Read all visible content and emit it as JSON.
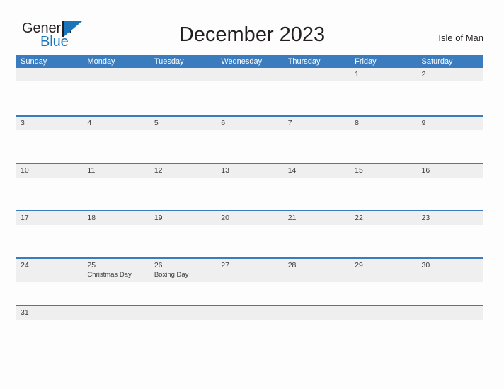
{
  "logo": {
    "word_general": "General",
    "word_blue": "Blue"
  },
  "header": {
    "title": "December 2023",
    "location": "Isle of Man"
  },
  "colors": {
    "header_blue": "#3a7cbd",
    "day_strip_gray": "#efefef",
    "logo_blue": "#1b75bb",
    "text_dark": "#231f20",
    "page_background": "#fdfdfd"
  },
  "calendar": {
    "weekdays": [
      "Sunday",
      "Monday",
      "Tuesday",
      "Wednesday",
      "Thursday",
      "Friday",
      "Saturday"
    ],
    "weeks": [
      {
        "tall": false,
        "days": [
          {
            "num": "",
            "event": ""
          },
          {
            "num": "",
            "event": ""
          },
          {
            "num": "",
            "event": ""
          },
          {
            "num": "",
            "event": ""
          },
          {
            "num": "",
            "event": ""
          },
          {
            "num": "1",
            "event": ""
          },
          {
            "num": "2",
            "event": ""
          }
        ]
      },
      {
        "tall": false,
        "days": [
          {
            "num": "3",
            "event": ""
          },
          {
            "num": "4",
            "event": ""
          },
          {
            "num": "5",
            "event": ""
          },
          {
            "num": "6",
            "event": ""
          },
          {
            "num": "7",
            "event": ""
          },
          {
            "num": "8",
            "event": ""
          },
          {
            "num": "9",
            "event": ""
          }
        ]
      },
      {
        "tall": false,
        "days": [
          {
            "num": "10",
            "event": ""
          },
          {
            "num": "11",
            "event": ""
          },
          {
            "num": "12",
            "event": ""
          },
          {
            "num": "13",
            "event": ""
          },
          {
            "num": "14",
            "event": ""
          },
          {
            "num": "15",
            "event": ""
          },
          {
            "num": "16",
            "event": ""
          }
        ]
      },
      {
        "tall": false,
        "days": [
          {
            "num": "17",
            "event": ""
          },
          {
            "num": "18",
            "event": ""
          },
          {
            "num": "19",
            "event": ""
          },
          {
            "num": "20",
            "event": ""
          },
          {
            "num": "21",
            "event": ""
          },
          {
            "num": "22",
            "event": ""
          },
          {
            "num": "23",
            "event": ""
          }
        ]
      },
      {
        "tall": true,
        "days": [
          {
            "num": "24",
            "event": ""
          },
          {
            "num": "25",
            "event": "Christmas Day"
          },
          {
            "num": "26",
            "event": "Boxing Day"
          },
          {
            "num": "27",
            "event": ""
          },
          {
            "num": "28",
            "event": ""
          },
          {
            "num": "29",
            "event": ""
          },
          {
            "num": "30",
            "event": ""
          }
        ]
      },
      {
        "tall": false,
        "days": [
          {
            "num": "31",
            "event": ""
          },
          {
            "num": "",
            "event": ""
          },
          {
            "num": "",
            "event": ""
          },
          {
            "num": "",
            "event": ""
          },
          {
            "num": "",
            "event": ""
          },
          {
            "num": "",
            "event": ""
          },
          {
            "num": "",
            "event": ""
          }
        ]
      }
    ]
  }
}
